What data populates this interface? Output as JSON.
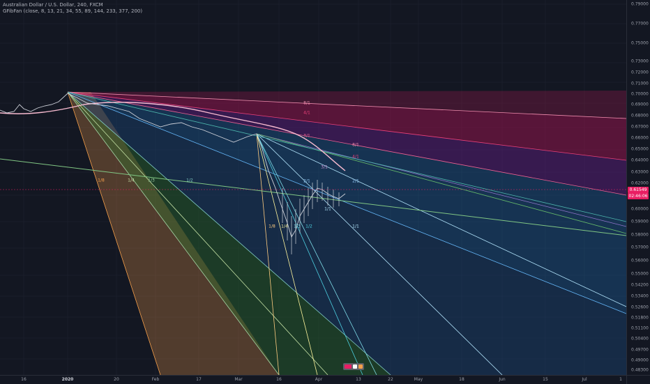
{
  "header": {
    "symbol_line": "Australian Dollar / U.S. Dollar, 240, FXCM",
    "indicator_line": "GFibFan (close, 8, 13, 21, 34, 55, 89, 144, 233, 377, 200)"
  },
  "price_axis": {
    "ticks": [
      "0.79000",
      "0.77000",
      "0.75000",
      "0.73000",
      "0.72000",
      "0.71000",
      "0.70000",
      "0.69000",
      "0.68000",
      "0.67000",
      "0.66000",
      "0.65000",
      "0.64000",
      "0.63000",
      "0.62000",
      "0.60000",
      "0.59000",
      "0.58000",
      "0.57000",
      "0.56000",
      "0.55000",
      "0.54200",
      "0.53400",
      "0.52600",
      "0.51800",
      "0.51100",
      "0.50400",
      "0.49700",
      "0.49000",
      "0.48300"
    ],
    "current_price": "0.61549",
    "countdown": "02:46:06"
  },
  "time_axis": {
    "ticks": [
      {
        "label": "16",
        "bold": false
      },
      {
        "label": "2020",
        "bold": true
      },
      {
        "label": "20",
        "bold": false
      },
      {
        "label": "Feb",
        "bold": false
      },
      {
        "label": "17",
        "bold": false
      },
      {
        "label": "Mar",
        "bold": false
      },
      {
        "label": "16",
        "bold": false
      },
      {
        "label": "Apr",
        "bold": false
      },
      {
        "label": "13",
        "bold": false
      },
      {
        "label": "22",
        "bold": false
      },
      {
        "label": "May",
        "bold": false
      },
      {
        "label": "18",
        "bold": false
      },
      {
        "label": "Jun",
        "bold": false
      },
      {
        "label": "15",
        "bold": false
      },
      {
        "label": "Jul",
        "bold": false
      },
      {
        "label": "1",
        "bold": false
      }
    ]
  },
  "fan_labels_lower": [
    "1/8",
    "1/4",
    "1/3",
    "1/2"
  ],
  "fan_labels_upper": [
    "8/1",
    "4/1",
    "3/1",
    "2/1",
    "1/1"
  ],
  "fan_labels_second": [
    "8/1",
    "4/1",
    "3/1",
    "2/1",
    "1/1"
  ],
  "fan_labels_inner": [
    "1/8",
    "1/4",
    "1/3",
    "1/2"
  ],
  "colors": {
    "background": "#131722",
    "candle_up": "#d1d4dc",
    "price_badge": "#e91e63",
    "fan_orange": "#f59f4a",
    "fan_green": "#2e7d32",
    "fan_blue": "#1e88e5",
    "fan_magenta": "#c2185b"
  },
  "logo": "tradingview-logo"
}
